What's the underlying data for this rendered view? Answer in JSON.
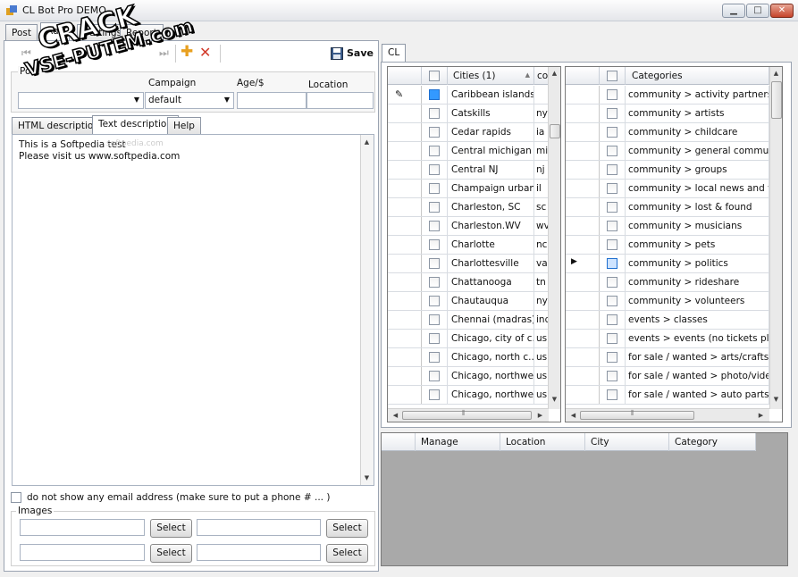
{
  "window": {
    "title": "CL Bot Pro DEMO",
    "minimize": "▁",
    "maximize": "□",
    "close": "✕"
  },
  "main_tabs": [
    "Post",
    "Ads",
    "Settings",
    "Report"
  ],
  "toolbar": {
    "save_label": "Save",
    "add_icon": "plus-icon",
    "delete_icon": "x-icon"
  },
  "form": {
    "post_label": "Post",
    "campaign_label": "Campaign",
    "campaign_value": "default",
    "age_label": "Age/$",
    "location_label": "Location"
  },
  "desc_tabs": [
    "HTML description",
    "Text description",
    "Help"
  ],
  "description_text": "This is a Softpedia test\nPlease visit us www.softpedia.com",
  "faded_text": "softpedia.com",
  "email_checkbox_label": "do not show any email address (make sure to put a phone # ... )",
  "images": {
    "label": "Images",
    "select_label": "Select"
  },
  "cl_tab": "CL",
  "cities_grid": {
    "headers": [
      "Cities (1)",
      "co"
    ],
    "rows": [
      [
        "Caribbean islands",
        ""
      ],
      [
        "Catskills",
        "ny"
      ],
      [
        "Cedar rapids",
        "ia"
      ],
      [
        "Central michigan",
        "mi"
      ],
      [
        "Central NJ",
        "nj"
      ],
      [
        "Champaign urbana",
        "il"
      ],
      [
        "Charleston, SC",
        "sc"
      ],
      [
        "Charleston.WV",
        "wv"
      ],
      [
        "Charlotte",
        "nc"
      ],
      [
        "Charlottesville",
        "va"
      ],
      [
        "Chattanooga",
        "tn"
      ],
      [
        "Chautauqua",
        "ny"
      ],
      [
        "Chennai (madras)",
        "ind"
      ],
      [
        "Chicago, city of c...",
        "us"
      ],
      [
        "Chicago, north c...",
        "us"
      ],
      [
        "Chicago, northwe...",
        "us"
      ],
      [
        "Chicago, northwe...",
        "us"
      ]
    ]
  },
  "categories_grid": {
    "header": "Categories",
    "rows": [
      "community > activity partners",
      "community > artists",
      "community > childcare",
      "community > general community",
      "community > groups",
      "community > local news and views",
      "community > lost & found",
      "community > musicians",
      "community > pets",
      "community > politics",
      "community > rideshare",
      "community > volunteers",
      "events > classes",
      "events > events (no tickets please",
      "for sale / wanted >  arts/crafts for s",
      "for sale / wanted >  photo/video fo",
      "for sale / wanted > auto parts"
    ]
  },
  "bottom_grid": {
    "headers": [
      "Manage",
      "Location",
      "City",
      "Category"
    ]
  },
  "watermark": {
    "line1": "CRACK",
    "line2": "VSE-PUTEM.com"
  }
}
